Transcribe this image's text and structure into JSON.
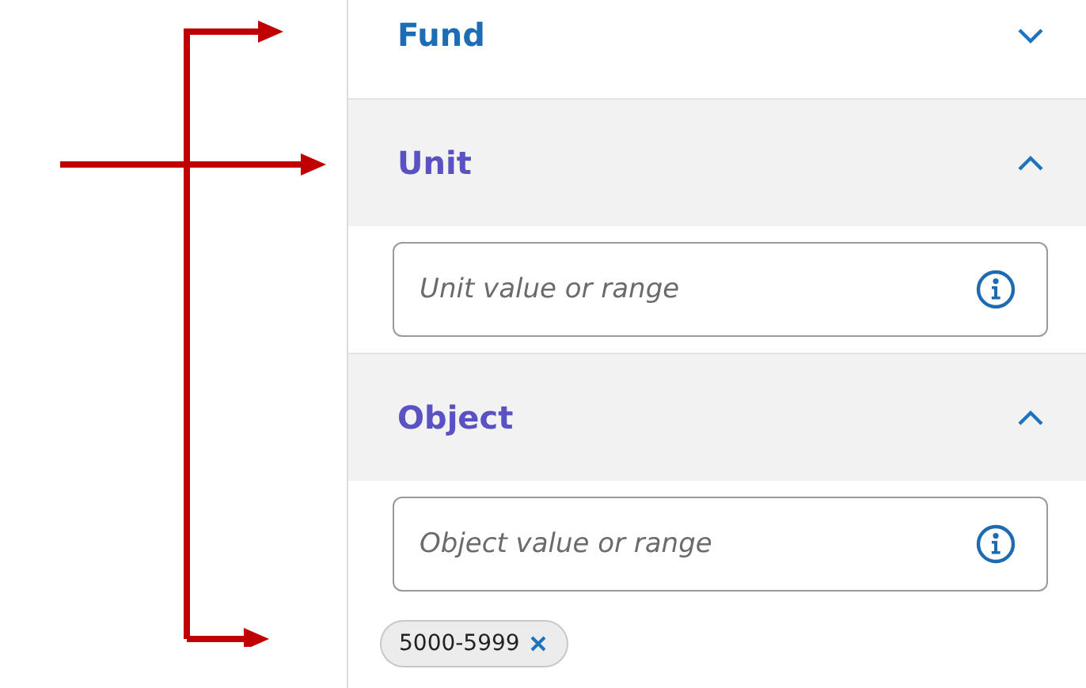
{
  "sections": [
    {
      "title": "Fund",
      "expanded": false
    },
    {
      "title": "Unit",
      "expanded": true,
      "field": {
        "placeholder": "Unit value or range"
      }
    },
    {
      "title": "Object",
      "expanded": true,
      "field": {
        "placeholder": "Object value or range"
      },
      "chips": [
        "5000-5999"
      ]
    }
  ]
}
